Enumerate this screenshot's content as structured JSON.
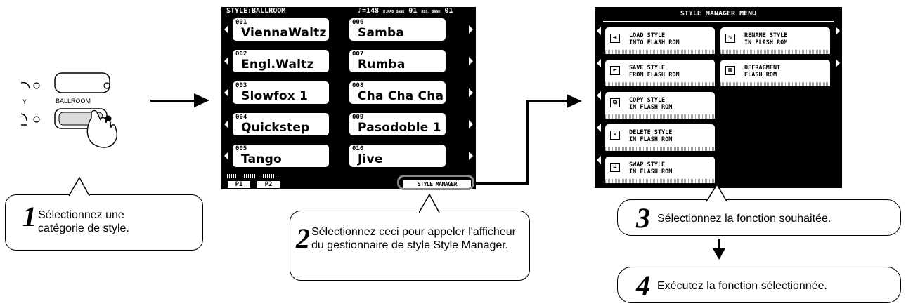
{
  "panel": {
    "label_y": "Y",
    "label_ballroom": "BALLROOM"
  },
  "lcd1": {
    "title": "STYLE:BALLROOM",
    "status": "♪=148 | M.PAD BANK 01 | REG. BANK 01",
    "tempo": "=148",
    "mpad_label": "M.PAD BANK",
    "mpad_value": "01",
    "reg_label": "REG. BANK",
    "reg_value": "01",
    "styles": [
      {
        "num": "001",
        "name": "ViennaWaltz"
      },
      {
        "num": "002",
        "name": "Engl.Waltz"
      },
      {
        "num": "003",
        "name": "Slowfox 1"
      },
      {
        "num": "004",
        "name": "Quickstep"
      },
      {
        "num": "005",
        "name": "Tango"
      },
      {
        "num": "006",
        "name": "Samba"
      },
      {
        "num": "007",
        "name": "Rumba"
      },
      {
        "num": "008",
        "name": "Cha Cha Cha"
      },
      {
        "num": "009",
        "name": "Pasodoble 1"
      },
      {
        "num": "010",
        "name": "Jive"
      }
    ],
    "tabs": [
      "P1",
      "P2"
    ],
    "style_manager": "STYLE MANAGER"
  },
  "lcd2": {
    "title": "STYLE MANAGER MENU",
    "items": [
      {
        "label": "LOAD STYLE\nINTO FLASH ROM",
        "icon": "load-icon"
      },
      {
        "label": "SAVE STYLE\nFROM FLASH ROM",
        "icon": "save-icon"
      },
      {
        "label": "COPY STYLE\nIN FLASH ROM",
        "icon": "copy-icon"
      },
      {
        "label": "DELETE STYLE\nIN FLASH ROM",
        "icon": "delete-icon"
      },
      {
        "label": "SWAP STYLE\nIN FLASH ROM",
        "icon": "swap-icon"
      },
      {
        "label": "RENAME STYLE\nIN FLASH ROM",
        "icon": "rename-icon"
      },
      {
        "label": "DEFRAGMENT\nFLASH ROM",
        "icon": "defragment-icon"
      }
    ]
  },
  "callouts": {
    "c1": {
      "num": "1",
      "text": "Sélectionnez une catégorie de style."
    },
    "c2": {
      "num": "2",
      "text": "Sélectionnez ceci pour appeler l'afficheur du gestionnaire de style Style Manager."
    },
    "c3": {
      "num": "3",
      "text": "Sélectionnez la fonction souhaitée."
    },
    "c4": {
      "num": "4",
      "text": "Exécutez la fonction sélectionnée."
    }
  }
}
